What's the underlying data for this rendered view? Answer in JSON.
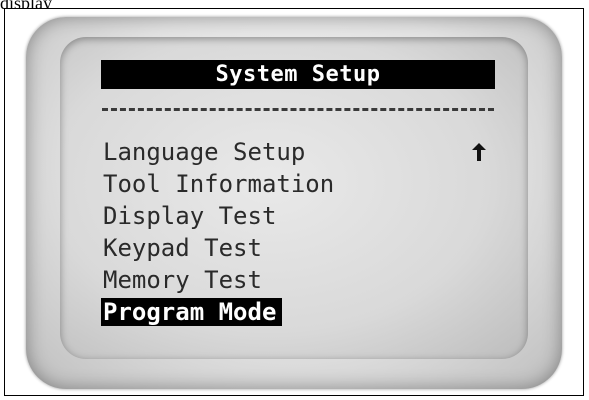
{
  "caption": "     display",
  "screen": {
    "title": "System Setup",
    "divider": "--------------------",
    "menu": [
      {
        "label": "Language Setup",
        "selected": false
      },
      {
        "label": "Tool Information",
        "selected": false
      },
      {
        "label": "Display Test",
        "selected": false
      },
      {
        "label": "Keypad Test",
        "selected": false
      },
      {
        "label": "Memory Test",
        "selected": false
      },
      {
        "label": "Program Mode",
        "selected": true
      }
    ],
    "scroll_indicator_icon": "up-arrow-icon"
  }
}
